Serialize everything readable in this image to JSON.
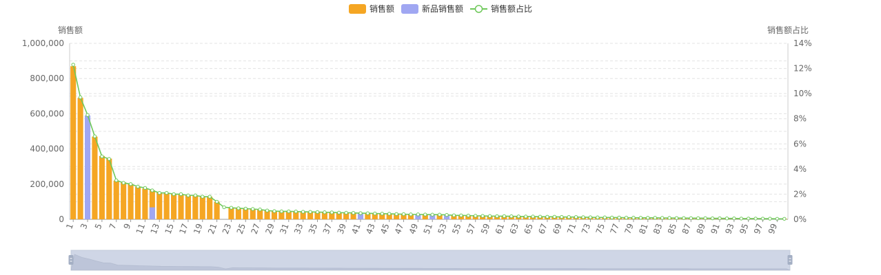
{
  "legend": {
    "sales": "销售额",
    "new_sales": "新品销售额",
    "ratio": "销售额占比"
  },
  "axes": {
    "left_name": "销售额",
    "right_name": "销售额占比"
  },
  "colors": {
    "sales": "#f5a623",
    "new_sales": "#a0a7f2",
    "line": "#6ec85a",
    "grid": "#e3e3e3",
    "axis_text": "#666666",
    "zoom_bg": "#d8dfeb",
    "zoom_area": "#b9c2d6",
    "zoom_handle": "#a4afc4"
  },
  "chart_data": {
    "type": "bar",
    "title": "",
    "categories": [
      "1",
      "2",
      "3",
      "4",
      "5",
      "6",
      "7",
      "8",
      "9",
      "10",
      "11",
      "12",
      "13",
      "14",
      "15",
      "16",
      "17",
      "18",
      "19",
      "20",
      "21",
      "22",
      "23",
      "24",
      "25",
      "26",
      "27",
      "28",
      "29",
      "30",
      "31",
      "32",
      "33",
      "34",
      "35",
      "36",
      "37",
      "38",
      "39",
      "40",
      "41",
      "42",
      "43",
      "44",
      "45",
      "46",
      "47",
      "48",
      "49",
      "50",
      "51",
      "52",
      "53",
      "54",
      "55",
      "56",
      "57",
      "58",
      "59",
      "60",
      "61",
      "62",
      "63",
      "64",
      "65",
      "66",
      "67",
      "68",
      "69",
      "70",
      "71",
      "72",
      "73",
      "74",
      "75",
      "76",
      "77",
      "78",
      "79",
      "80",
      "81",
      "82",
      "83",
      "84",
      "85",
      "86",
      "87",
      "88",
      "89",
      "90",
      "91",
      "92",
      "93",
      "94",
      "95",
      "96",
      "97",
      "98",
      "99",
      "100"
    ],
    "x_tick_labels": [
      "1",
      "3",
      "5",
      "7",
      "9",
      "11",
      "13",
      "15",
      "17",
      "19",
      "21",
      "23",
      "25",
      "27",
      "29",
      "31",
      "33",
      "35",
      "37",
      "39",
      "41",
      "43",
      "45",
      "47",
      "49",
      "51",
      "53",
      "55",
      "57",
      "59",
      "61",
      "63",
      "65",
      "67",
      "69",
      "71",
      "73",
      "75",
      "77",
      "79",
      "81",
      "83",
      "85",
      "87",
      "89",
      "91",
      "93",
      "95",
      "97",
      "99"
    ],
    "left_axis": {
      "ylim": [
        0,
        1000000
      ],
      "ticks": [
        "0",
        "200,000",
        "400,000",
        "600,000",
        "800,000",
        "1,000,000"
      ]
    },
    "right_axis": {
      "ylim": [
        0,
        14
      ],
      "ticks": [
        "0%",
        "2%",
        "4%",
        "6%",
        "8%",
        "10%",
        "12%",
        "14%"
      ]
    },
    "series": [
      {
        "name": "销售额",
        "axis": "left",
        "kind": "bar",
        "values": [
          870000,
          690000,
          0,
          470000,
          360000,
          345000,
          220000,
          210000,
          200000,
          185000,
          175000,
          165000,
          152000,
          150000,
          145000,
          140000,
          138000,
          133000,
          130000,
          128000,
          100000,
          0,
          65000,
          62000,
          60000,
          58000,
          55000,
          50000,
          46000,
          45000,
          45000,
          44000,
          43000,
          42000,
          41000,
          40000,
          39000,
          38000,
          37000,
          36000,
          0,
          34000,
          33000,
          32000,
          31000,
          30000,
          29000,
          28000,
          0,
          27000,
          0,
          26000,
          0,
          23000,
          22000,
          21000,
          20000,
          19000,
          18500,
          18000,
          17500,
          17000,
          16500,
          16000,
          15500,
          15000,
          14500,
          14000,
          13500,
          13000,
          12500,
          12000,
          11500,
          11000,
          10500,
          10000,
          9700,
          9400,
          9100,
          8800,
          8500,
          8200,
          7900,
          7600,
          7300,
          7000,
          6700,
          6400,
          6100,
          5800,
          5500,
          5200,
          4900,
          4600,
          4300,
          4000,
          3700,
          3400,
          3100,
          2800
        ]
      },
      {
        "name": "新品销售额",
        "axis": "left",
        "kind": "bar",
        "values": [
          0,
          0,
          590000,
          0,
          0,
          0,
          0,
          0,
          0,
          0,
          0,
          68000,
          0,
          0,
          0,
          0,
          0,
          0,
          0,
          0,
          0,
          0,
          0,
          0,
          0,
          0,
          0,
          0,
          0,
          0,
          0,
          0,
          0,
          0,
          0,
          0,
          0,
          0,
          0,
          0,
          35000,
          0,
          0,
          0,
          0,
          0,
          0,
          0,
          28000,
          0,
          26500,
          0,
          25000,
          0,
          0,
          0,
          0,
          0,
          0,
          0,
          0,
          0,
          0,
          0,
          0,
          0,
          0,
          0,
          0,
          0,
          0,
          0,
          0,
          0,
          0,
          0,
          0,
          0,
          0,
          0,
          0,
          0,
          0,
          0,
          0,
          0,
          0,
          0,
          0,
          0,
          0,
          0,
          0,
          0,
          0,
          0,
          0,
          0,
          0,
          0
        ]
      },
      {
        "name": "销售额占比",
        "axis": "right",
        "kind": "line",
        "values": [
          12.3,
          9.7,
          8.3,
          6.6,
          5.0,
          4.8,
          3.1,
          2.9,
          2.8,
          2.6,
          2.5,
          2.3,
          2.1,
          2.1,
          2.0,
          2.0,
          1.9,
          1.9,
          1.8,
          1.8,
          1.4,
          0.96,
          0.92,
          0.88,
          0.85,
          0.82,
          0.78,
          0.7,
          0.65,
          0.63,
          0.63,
          0.62,
          0.6,
          0.59,
          0.58,
          0.56,
          0.55,
          0.53,
          0.52,
          0.51,
          0.49,
          0.48,
          0.46,
          0.45,
          0.44,
          0.42,
          0.41,
          0.39,
          0.39,
          0.38,
          0.37,
          0.37,
          0.35,
          0.32,
          0.31,
          0.3,
          0.28,
          0.27,
          0.26,
          0.25,
          0.25,
          0.24,
          0.23,
          0.22,
          0.22,
          0.21,
          0.2,
          0.2,
          0.19,
          0.18,
          0.18,
          0.17,
          0.16,
          0.15,
          0.15,
          0.14,
          0.14,
          0.13,
          0.13,
          0.12,
          0.12,
          0.12,
          0.11,
          0.11,
          0.1,
          0.1,
          0.09,
          0.09,
          0.09,
          0.08,
          0.08,
          0.07,
          0.07,
          0.06,
          0.06,
          0.06,
          0.05,
          0.05,
          0.04,
          0.04
        ]
      }
    ],
    "grid": true,
    "legend_position": "top-center",
    "datazoom": {
      "start": 0,
      "end": 100
    }
  }
}
